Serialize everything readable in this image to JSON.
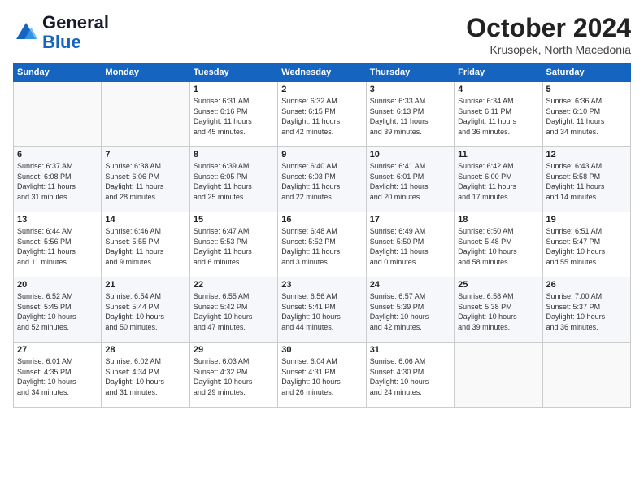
{
  "header": {
    "logo_general": "General",
    "logo_blue": "Blue",
    "month": "October 2024",
    "location": "Krusopek, North Macedonia"
  },
  "weekdays": [
    "Sunday",
    "Monday",
    "Tuesday",
    "Wednesday",
    "Thursday",
    "Friday",
    "Saturday"
  ],
  "weeks": [
    [
      {
        "day": "",
        "info": ""
      },
      {
        "day": "",
        "info": ""
      },
      {
        "day": "1",
        "info": "Sunrise: 6:31 AM\nSunset: 6:16 PM\nDaylight: 11 hours\nand 45 minutes."
      },
      {
        "day": "2",
        "info": "Sunrise: 6:32 AM\nSunset: 6:15 PM\nDaylight: 11 hours\nand 42 minutes."
      },
      {
        "day": "3",
        "info": "Sunrise: 6:33 AM\nSunset: 6:13 PM\nDaylight: 11 hours\nand 39 minutes."
      },
      {
        "day": "4",
        "info": "Sunrise: 6:34 AM\nSunset: 6:11 PM\nDaylight: 11 hours\nand 36 minutes."
      },
      {
        "day": "5",
        "info": "Sunrise: 6:36 AM\nSunset: 6:10 PM\nDaylight: 11 hours\nand 34 minutes."
      }
    ],
    [
      {
        "day": "6",
        "info": "Sunrise: 6:37 AM\nSunset: 6:08 PM\nDaylight: 11 hours\nand 31 minutes."
      },
      {
        "day": "7",
        "info": "Sunrise: 6:38 AM\nSunset: 6:06 PM\nDaylight: 11 hours\nand 28 minutes."
      },
      {
        "day": "8",
        "info": "Sunrise: 6:39 AM\nSunset: 6:05 PM\nDaylight: 11 hours\nand 25 minutes."
      },
      {
        "day": "9",
        "info": "Sunrise: 6:40 AM\nSunset: 6:03 PM\nDaylight: 11 hours\nand 22 minutes."
      },
      {
        "day": "10",
        "info": "Sunrise: 6:41 AM\nSunset: 6:01 PM\nDaylight: 11 hours\nand 20 minutes."
      },
      {
        "day": "11",
        "info": "Sunrise: 6:42 AM\nSunset: 6:00 PM\nDaylight: 11 hours\nand 17 minutes."
      },
      {
        "day": "12",
        "info": "Sunrise: 6:43 AM\nSunset: 5:58 PM\nDaylight: 11 hours\nand 14 minutes."
      }
    ],
    [
      {
        "day": "13",
        "info": "Sunrise: 6:44 AM\nSunset: 5:56 PM\nDaylight: 11 hours\nand 11 minutes."
      },
      {
        "day": "14",
        "info": "Sunrise: 6:46 AM\nSunset: 5:55 PM\nDaylight: 11 hours\nand 9 minutes."
      },
      {
        "day": "15",
        "info": "Sunrise: 6:47 AM\nSunset: 5:53 PM\nDaylight: 11 hours\nand 6 minutes."
      },
      {
        "day": "16",
        "info": "Sunrise: 6:48 AM\nSunset: 5:52 PM\nDaylight: 11 hours\nand 3 minutes."
      },
      {
        "day": "17",
        "info": "Sunrise: 6:49 AM\nSunset: 5:50 PM\nDaylight: 11 hours\nand 0 minutes."
      },
      {
        "day": "18",
        "info": "Sunrise: 6:50 AM\nSunset: 5:48 PM\nDaylight: 10 hours\nand 58 minutes."
      },
      {
        "day": "19",
        "info": "Sunrise: 6:51 AM\nSunset: 5:47 PM\nDaylight: 10 hours\nand 55 minutes."
      }
    ],
    [
      {
        "day": "20",
        "info": "Sunrise: 6:52 AM\nSunset: 5:45 PM\nDaylight: 10 hours\nand 52 minutes."
      },
      {
        "day": "21",
        "info": "Sunrise: 6:54 AM\nSunset: 5:44 PM\nDaylight: 10 hours\nand 50 minutes."
      },
      {
        "day": "22",
        "info": "Sunrise: 6:55 AM\nSunset: 5:42 PM\nDaylight: 10 hours\nand 47 minutes."
      },
      {
        "day": "23",
        "info": "Sunrise: 6:56 AM\nSunset: 5:41 PM\nDaylight: 10 hours\nand 44 minutes."
      },
      {
        "day": "24",
        "info": "Sunrise: 6:57 AM\nSunset: 5:39 PM\nDaylight: 10 hours\nand 42 minutes."
      },
      {
        "day": "25",
        "info": "Sunrise: 6:58 AM\nSunset: 5:38 PM\nDaylight: 10 hours\nand 39 minutes."
      },
      {
        "day": "26",
        "info": "Sunrise: 7:00 AM\nSunset: 5:37 PM\nDaylight: 10 hours\nand 36 minutes."
      }
    ],
    [
      {
        "day": "27",
        "info": "Sunrise: 6:01 AM\nSunset: 4:35 PM\nDaylight: 10 hours\nand 34 minutes."
      },
      {
        "day": "28",
        "info": "Sunrise: 6:02 AM\nSunset: 4:34 PM\nDaylight: 10 hours\nand 31 minutes."
      },
      {
        "day": "29",
        "info": "Sunrise: 6:03 AM\nSunset: 4:32 PM\nDaylight: 10 hours\nand 29 minutes."
      },
      {
        "day": "30",
        "info": "Sunrise: 6:04 AM\nSunset: 4:31 PM\nDaylight: 10 hours\nand 26 minutes."
      },
      {
        "day": "31",
        "info": "Sunrise: 6:06 AM\nSunset: 4:30 PM\nDaylight: 10 hours\nand 24 minutes."
      },
      {
        "day": "",
        "info": ""
      },
      {
        "day": "",
        "info": ""
      }
    ]
  ]
}
